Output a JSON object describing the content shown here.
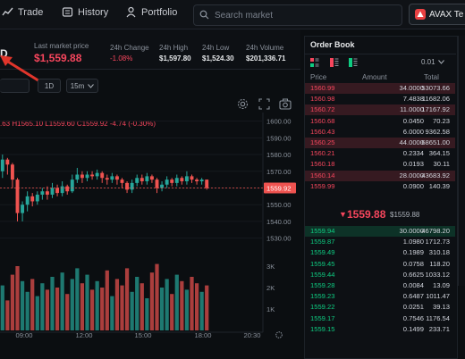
{
  "nav": {
    "trade": "Trade",
    "history": "History",
    "portfolio": "Portfolio",
    "search_placeholder": "Search market",
    "avax_button": "AVAX Te"
  },
  "market": {
    "symbol_tail": "D",
    "last_price_label": "Last market price",
    "last_price": "$1,559.88",
    "change_label": "24h Change",
    "change": "-1.08%",
    "high_label": "24h High",
    "high": "$1,597.80",
    "low_label": "24h Low",
    "low": "$1,524.30",
    "volume_label": "24h Volume",
    "volume": "$201,336.71"
  },
  "toolbar": {
    "interval_1d": "1D",
    "interval_15m": "15m"
  },
  "chart": {
    "ohlc_open_tail": ".63",
    "ohlc_h": "H1565.10",
    "ohlc_l": "L1559.60",
    "ohlc_c": "C1559.92",
    "ohlc_change": "-4.74 (-0.30%)",
    "current_price_tag": "1559.92"
  },
  "chart_data": {
    "type": "candlestick",
    "y_ticks": [
      "1600.00",
      "1590.00",
      "1580.00",
      "1570.00",
      "1560.00",
      "1550.00",
      "1540.00",
      "1530.00"
    ],
    "ylim": [
      1525,
      1603
    ],
    "volume_ticks": [
      "3K",
      "2K",
      "1K"
    ],
    "x_ticks": [
      "09:00",
      "12:00",
      "15:00",
      "18:00",
      "20:30"
    ],
    "candles": [
      {
        "o": 1570,
        "c": 1577,
        "h": 1580,
        "l": 1566
      },
      {
        "o": 1577,
        "c": 1574,
        "h": 1578,
        "l": 1568
      },
      {
        "o": 1574,
        "c": 1565,
        "h": 1575,
        "l": 1560
      },
      {
        "o": 1565,
        "c": 1545,
        "h": 1566,
        "l": 1540
      },
      {
        "o": 1545,
        "c": 1550,
        "h": 1552,
        "l": 1540
      },
      {
        "o": 1550,
        "c": 1555,
        "h": 1558,
        "l": 1546
      },
      {
        "o": 1555,
        "c": 1552,
        "h": 1557,
        "l": 1549
      },
      {
        "o": 1552,
        "c": 1556,
        "h": 1558,
        "l": 1550
      },
      {
        "o": 1556,
        "c": 1558,
        "h": 1560,
        "l": 1553
      },
      {
        "o": 1558,
        "c": 1556,
        "h": 1561,
        "l": 1553
      },
      {
        "o": 1556,
        "c": 1560,
        "h": 1563,
        "l": 1554
      },
      {
        "o": 1560,
        "c": 1557,
        "h": 1562,
        "l": 1555
      },
      {
        "o": 1557,
        "c": 1561,
        "h": 1564,
        "l": 1555
      },
      {
        "o": 1561,
        "c": 1558,
        "h": 1562,
        "l": 1556
      },
      {
        "o": 1558,
        "c": 1565,
        "h": 1568,
        "l": 1557
      },
      {
        "o": 1565,
        "c": 1568,
        "h": 1572,
        "l": 1563
      },
      {
        "o": 1568,
        "c": 1566,
        "h": 1570,
        "l": 1563
      },
      {
        "o": 1566,
        "c": 1568,
        "h": 1570,
        "l": 1564
      },
      {
        "o": 1568,
        "c": 1567,
        "h": 1570,
        "l": 1565
      },
      {
        "o": 1567,
        "c": 1569,
        "h": 1571,
        "l": 1565
      },
      {
        "o": 1569,
        "c": 1566,
        "h": 1570,
        "l": 1563
      },
      {
        "o": 1566,
        "c": 1565,
        "h": 1568,
        "l": 1562
      },
      {
        "o": 1565,
        "c": 1567,
        "h": 1569,
        "l": 1563
      },
      {
        "o": 1567,
        "c": 1565,
        "h": 1568,
        "l": 1562
      },
      {
        "o": 1565,
        "c": 1563,
        "h": 1566,
        "l": 1560
      },
      {
        "o": 1563,
        "c": 1559,
        "h": 1564,
        "l": 1557
      },
      {
        "o": 1559,
        "c": 1563,
        "h": 1565,
        "l": 1557
      },
      {
        "o": 1563,
        "c": 1566,
        "h": 1568,
        "l": 1561
      },
      {
        "o": 1566,
        "c": 1564,
        "h": 1568,
        "l": 1562
      },
      {
        "o": 1564,
        "c": 1567,
        "h": 1569,
        "l": 1562
      },
      {
        "o": 1567,
        "c": 1565,
        "h": 1568,
        "l": 1563
      },
      {
        "o": 1565,
        "c": 1560,
        "h": 1566,
        "l": 1557
      },
      {
        "o": 1560,
        "c": 1562,
        "h": 1564,
        "l": 1558
      },
      {
        "o": 1562,
        "c": 1565,
        "h": 1567,
        "l": 1560
      },
      {
        "o": 1565,
        "c": 1563,
        "h": 1566,
        "l": 1561
      },
      {
        "o": 1563,
        "c": 1566,
        "h": 1568,
        "l": 1561
      },
      {
        "o": 1566,
        "c": 1564,
        "h": 1567,
        "l": 1562
      },
      {
        "o": 1564,
        "c": 1567,
        "h": 1570,
        "l": 1562
      },
      {
        "o": 1567,
        "c": 1565,
        "h": 1568,
        "l": 1563
      },
      {
        "o": 1565,
        "c": 1564,
        "h": 1566,
        "l": 1562
      },
      {
        "o": 1564,
        "c": 1565,
        "h": 1566,
        "l": 1562
      },
      {
        "o": 1565,
        "c": 1560,
        "h": 1565,
        "l": 1559
      }
    ],
    "volumes": [
      2.1,
      1.4,
      2.6,
      3.0,
      2.3,
      1.8,
      2.4,
      1.6,
      2.2,
      1.9,
      2.5,
      2.0,
      2.7,
      1.7,
      2.4,
      2.9,
      2.2,
      2.6,
      1.9,
      2.3,
      2.0,
      2.8,
      1.6,
      2.4,
      2.1,
      2.9,
      1.8,
      2.5,
      2.2,
      1.5,
      2.7,
      3.1,
      2.0,
      2.4,
      1.7,
      2.6,
      2.3,
      1.9,
      2.5,
      2.2,
      1.8,
      2.1
    ]
  },
  "orderbook": {
    "title": "Order Book",
    "step": "0.01",
    "col_price": "Price",
    "col_amount": "Amount",
    "col_total": "Total",
    "asks": [
      {
        "price": "1560.99",
        "amount": "34.0000",
        "total": "53073.66",
        "hl": true
      },
      {
        "price": "1560.98",
        "amount": "7.4838",
        "total": "11682.06",
        "hl": false
      },
      {
        "price": "1560.72",
        "amount": "11.0000",
        "total": "17167.92",
        "hl": true
      },
      {
        "price": "1560.68",
        "amount": "0.0450",
        "total": "70.23",
        "hl": false
      },
      {
        "price": "1560.43",
        "amount": "6.0000",
        "total": "9362.58",
        "hl": false
      },
      {
        "price": "1560.25",
        "amount": "44.0000",
        "total": "68651.00",
        "hl": true
      },
      {
        "price": "1560.21",
        "amount": "0.2334",
        "total": "364.15",
        "hl": false
      },
      {
        "price": "1560.18",
        "amount": "0.0193",
        "total": "30.11",
        "hl": false
      },
      {
        "price": "1560.14",
        "amount": "28.0000",
        "total": "43683.92",
        "hl": true
      },
      {
        "price": "1559.99",
        "amount": "0.0900",
        "total": "140.39",
        "hl": false
      }
    ],
    "mid_price": "1559.88",
    "mid_usd": "$1559.88",
    "bids": [
      {
        "price": "1559.94",
        "amount": "30.0000",
        "total": "46798.20",
        "hl": true
      },
      {
        "price": "1559.87",
        "amount": "1.0980",
        "total": "1712.73",
        "hl": false
      },
      {
        "price": "1559.49",
        "amount": "0.1989",
        "total": "310.18",
        "hl": false
      },
      {
        "price": "1559.45",
        "amount": "0.0758",
        "total": "118.20",
        "hl": false
      },
      {
        "price": "1559.44",
        "amount": "0.6625",
        "total": "1033.12",
        "hl": false
      },
      {
        "price": "1559.28",
        "amount": "0.0084",
        "total": "13.09",
        "hl": false
      },
      {
        "price": "1559.23",
        "amount": "0.6487",
        "total": "1011.47",
        "hl": false
      },
      {
        "price": "1559.22",
        "amount": "0.0251",
        "total": "39.13",
        "hl": false
      },
      {
        "price": "1559.17",
        "amount": "0.7546",
        "total": "1176.54",
        "hl": false
      },
      {
        "price": "1559.15",
        "amount": "0.1499",
        "total": "233.71",
        "hl": false
      }
    ]
  },
  "colors": {
    "up": "#26a69a",
    "down": "#ef5350",
    "ask": "#f6465d",
    "bid": "#0ecb81",
    "bg": "#0b0e11"
  }
}
